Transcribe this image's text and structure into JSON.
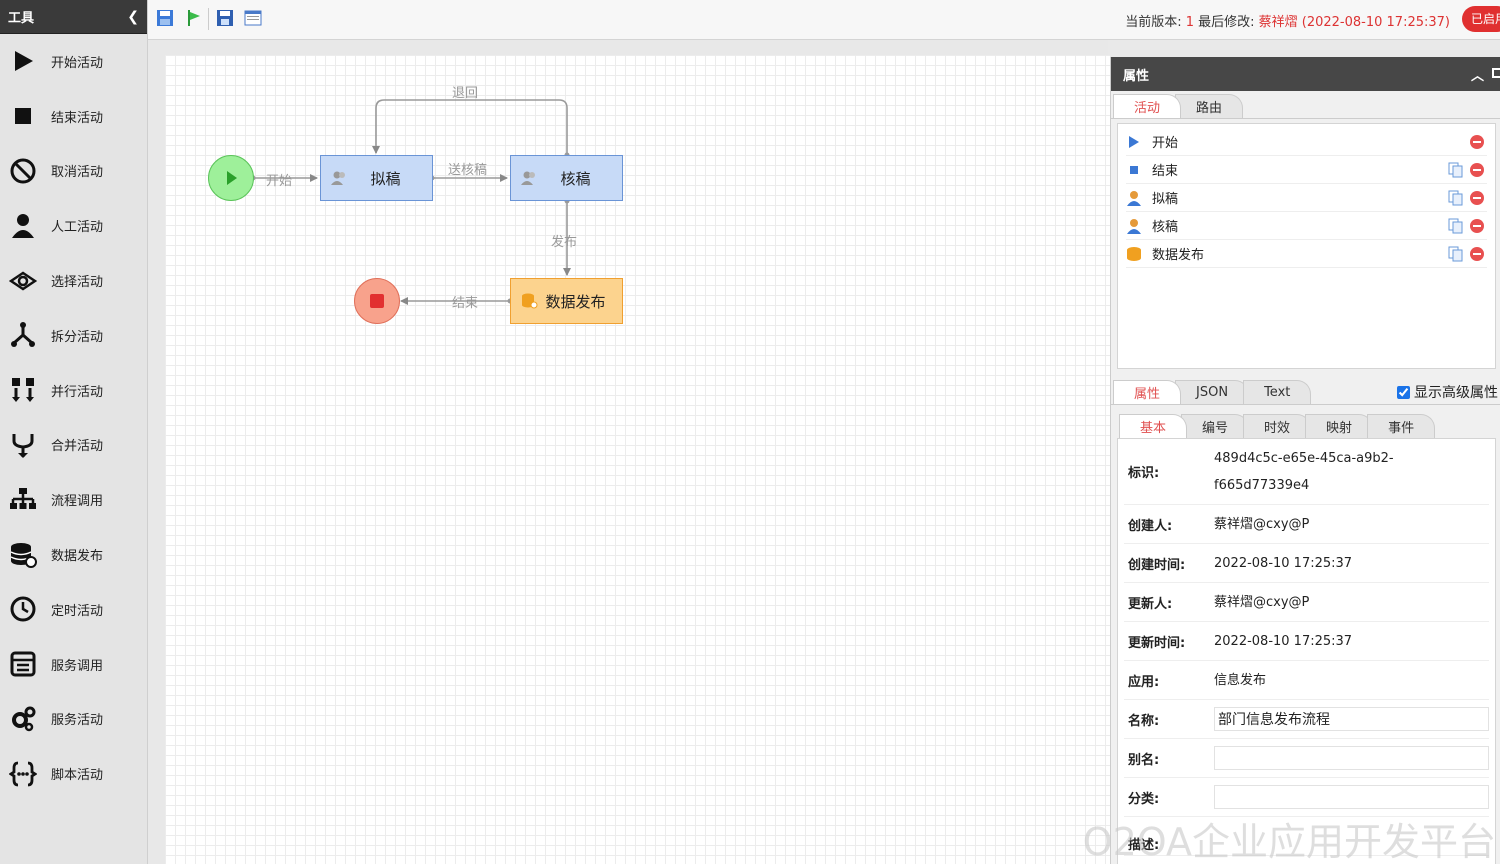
{
  "toolbox": {
    "title": "工具",
    "items": [
      {
        "label": "开始活动",
        "icon": "play-icon"
      },
      {
        "label": "结束活动",
        "icon": "stop-icon"
      },
      {
        "label": "取消活动",
        "icon": "ban-icon"
      },
      {
        "label": "人工活动",
        "icon": "user-icon"
      },
      {
        "label": "选择活动",
        "icon": "choice-icon"
      },
      {
        "label": "拆分活动",
        "icon": "split-icon"
      },
      {
        "label": "并行活动",
        "icon": "parallel-icon"
      },
      {
        "label": "合并活动",
        "icon": "merge-icon"
      },
      {
        "label": "流程调用",
        "icon": "hierarchy-icon"
      },
      {
        "label": "数据发布",
        "icon": "database-icon"
      },
      {
        "label": "定时活动",
        "icon": "clock-icon"
      },
      {
        "label": "服务调用",
        "icon": "service-icon"
      },
      {
        "label": "服务活动",
        "icon": "gears-icon"
      },
      {
        "label": "脚本活动",
        "icon": "code-icon"
      }
    ]
  },
  "topbar": {
    "version_prefix": "当前版本: ",
    "version": "1",
    "modified_prefix": " 最后修改: ",
    "modifier": "蔡祥熠 (2022-08-10 17:25:37)",
    "status_badge": "已启用"
  },
  "flow": {
    "nodes": {
      "start": "",
      "draft": "拟稿",
      "review": "核稿",
      "publish": "数据发布",
      "end": ""
    },
    "routes": {
      "begin": "开始",
      "send_review": "送核稿",
      "return": "退回",
      "publish": "发布",
      "finish": "结束"
    }
  },
  "props": {
    "title": "属性",
    "tabs": [
      "活动",
      "路由"
    ],
    "activities": [
      {
        "label": "开始",
        "type": "start"
      },
      {
        "label": "结束",
        "type": "end"
      },
      {
        "label": "拟稿",
        "type": "manual"
      },
      {
        "label": "核稿",
        "type": "manual"
      },
      {
        "label": "数据发布",
        "type": "publish"
      }
    ],
    "view_tabs": [
      "属性",
      "JSON",
      "Text"
    ],
    "advanced_label": "显示高级属性",
    "section_tabs": [
      "基本",
      "编号",
      "时效",
      "映射",
      "事件"
    ],
    "fields": {
      "id_label": "标识:",
      "id_line1": "489d4c5c-e65e-45ca-a9b2-",
      "id_line2": "f665d77339e4",
      "creator_label": "创建人:",
      "creator": "蔡祥熠@cxy@P",
      "created_label": "创建时间:",
      "created": "2022-08-10 17:25:37",
      "updater_label": "更新人:",
      "updater": "蔡祥熠@cxy@P",
      "updated_label": "更新时间:",
      "updated": "2022-08-10 17:25:37",
      "app_label": "应用:",
      "app": "信息发布",
      "name_label": "名称:",
      "name": "部门信息发布流程",
      "alias_label": "别名:",
      "alias": "",
      "category_label": "分类:",
      "category": "",
      "desc_label": "描述:"
    }
  },
  "watermark": "O2OA企业应用开发平台",
  "colors": {
    "accent_red": "#e05050",
    "task_fill": "#c7daf7",
    "publish_fill": "#fcd38e",
    "start_fill": "#9ef09a",
    "end_fill": "#f8a28c"
  }
}
